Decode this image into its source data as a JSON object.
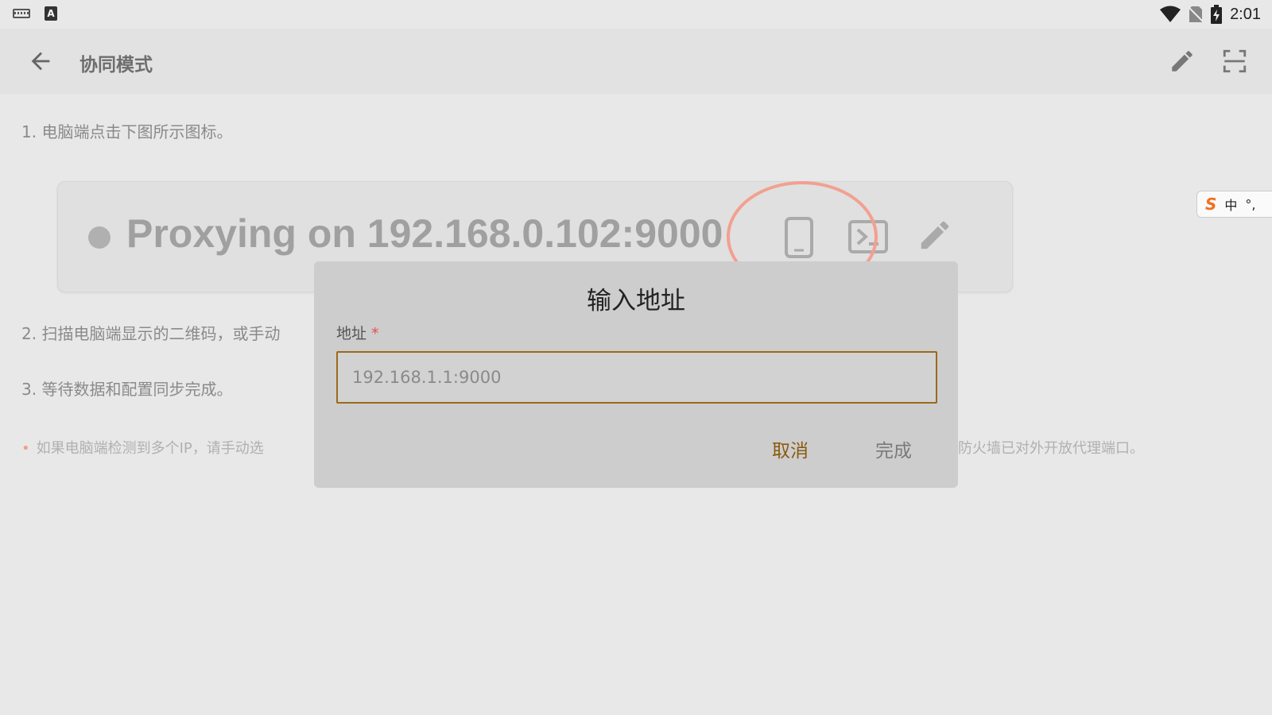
{
  "status": {
    "time": "2:01"
  },
  "appbar": {
    "title": "协同模式"
  },
  "steps": {
    "step1": "1. 电脑端点击下图所示图标。",
    "step2": "2. 扫描电脑端显示的二维码，或手动",
    "step3": "3. 等待数据和配置同步完成。",
    "note_left": "如果电脑端检测到多个IP，请手动选",
    "note_right": "防火墙已对外开放代理端口。"
  },
  "proxy": {
    "text": "Proxying on 192.168.0.102:9000"
  },
  "ime": {
    "lang": "中"
  },
  "dialog": {
    "title": "输入地址",
    "field_label": "地址",
    "required_mark": "*",
    "placeholder": "192.168.1.1:9000",
    "value": "",
    "cancel": "取消",
    "done": "完成"
  },
  "colors": {
    "accent": "#9a6a1a",
    "cancel_text": "#8a5a10",
    "highlight_circle": "#f3a090"
  }
}
